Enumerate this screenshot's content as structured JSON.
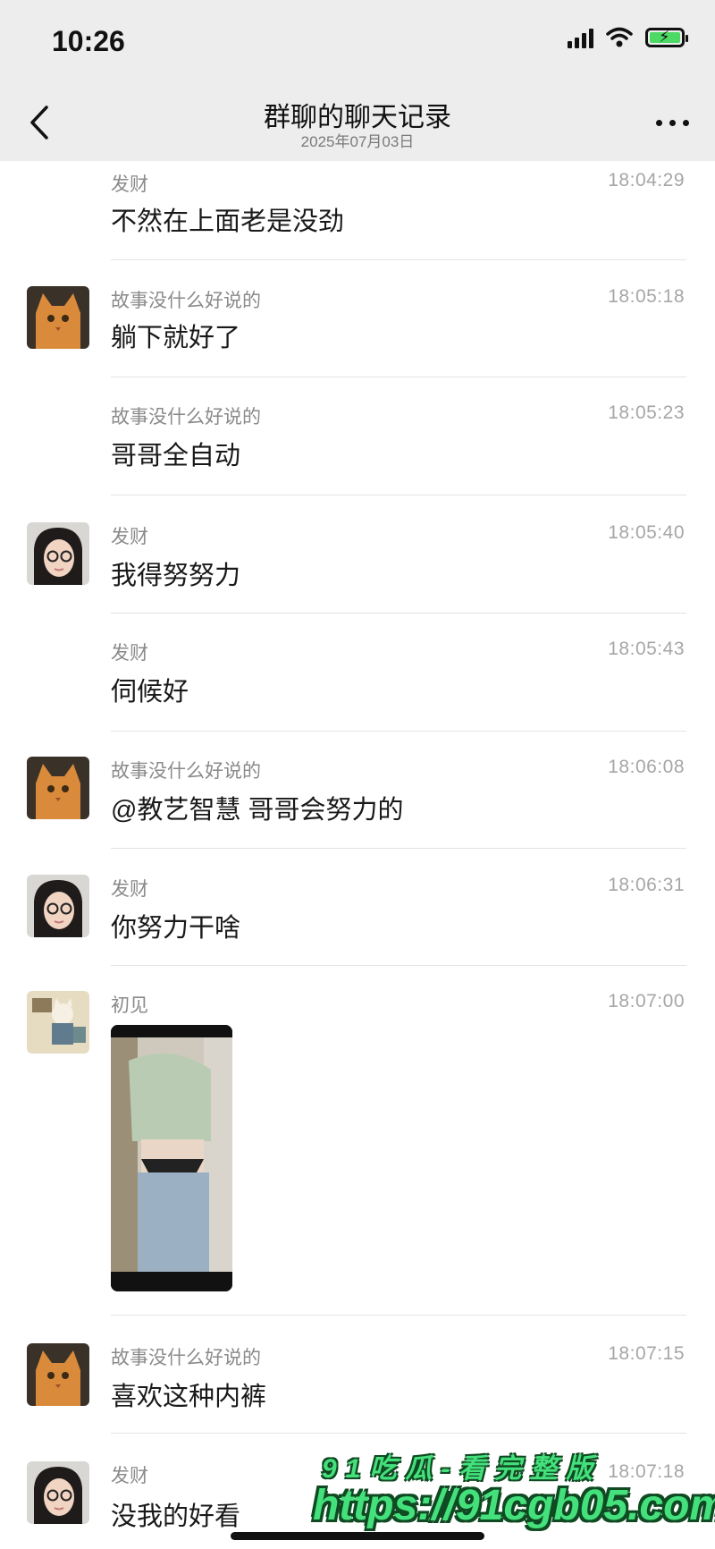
{
  "status_bar": {
    "time": "10:26",
    "battery_color": "#4cd964"
  },
  "header": {
    "title": "群聊的聊天记录",
    "subtitle": "2025年07月03日"
  },
  "messages": [
    {
      "sender": "发财",
      "time": "18:04:29",
      "text": "不然在上面老是没劲"
    },
    {
      "sender": "故事没什么好说的",
      "time": "18:05:18",
      "text": "躺下就好了",
      "avatar": "orange-cat"
    },
    {
      "sender": "故事没什么好说的",
      "time": "18:05:23",
      "text": "哥哥全自动"
    },
    {
      "sender": "发财",
      "time": "18:05:40",
      "text": "我得努努力",
      "avatar": "girl-glasses"
    },
    {
      "sender": "发财",
      "time": "18:05:43",
      "text": "伺候好"
    },
    {
      "sender": "故事没什么好说的",
      "time": "18:06:08",
      "text": "@教艺智慧 哥哥会努力的",
      "avatar": "orange-cat"
    },
    {
      "sender": "发财",
      "time": "18:06:31",
      "text": "你努力干啥",
      "avatar": "girl-glasses"
    },
    {
      "sender": "初见",
      "time": "18:07:00",
      "attachment": "screenshot-image",
      "avatar": "cartoon-illustration"
    },
    {
      "sender": "故事没什么好说的",
      "time": "18:07:15",
      "text": "喜欢这种内裤",
      "avatar": "orange-cat"
    },
    {
      "sender": "发财",
      "time": "18:07:18",
      "text": "没我的好看",
      "avatar": "girl-glasses"
    }
  ],
  "watermark": {
    "line1": "91吃瓜-看完整版",
    "line2": "https://91cgb05.com"
  }
}
